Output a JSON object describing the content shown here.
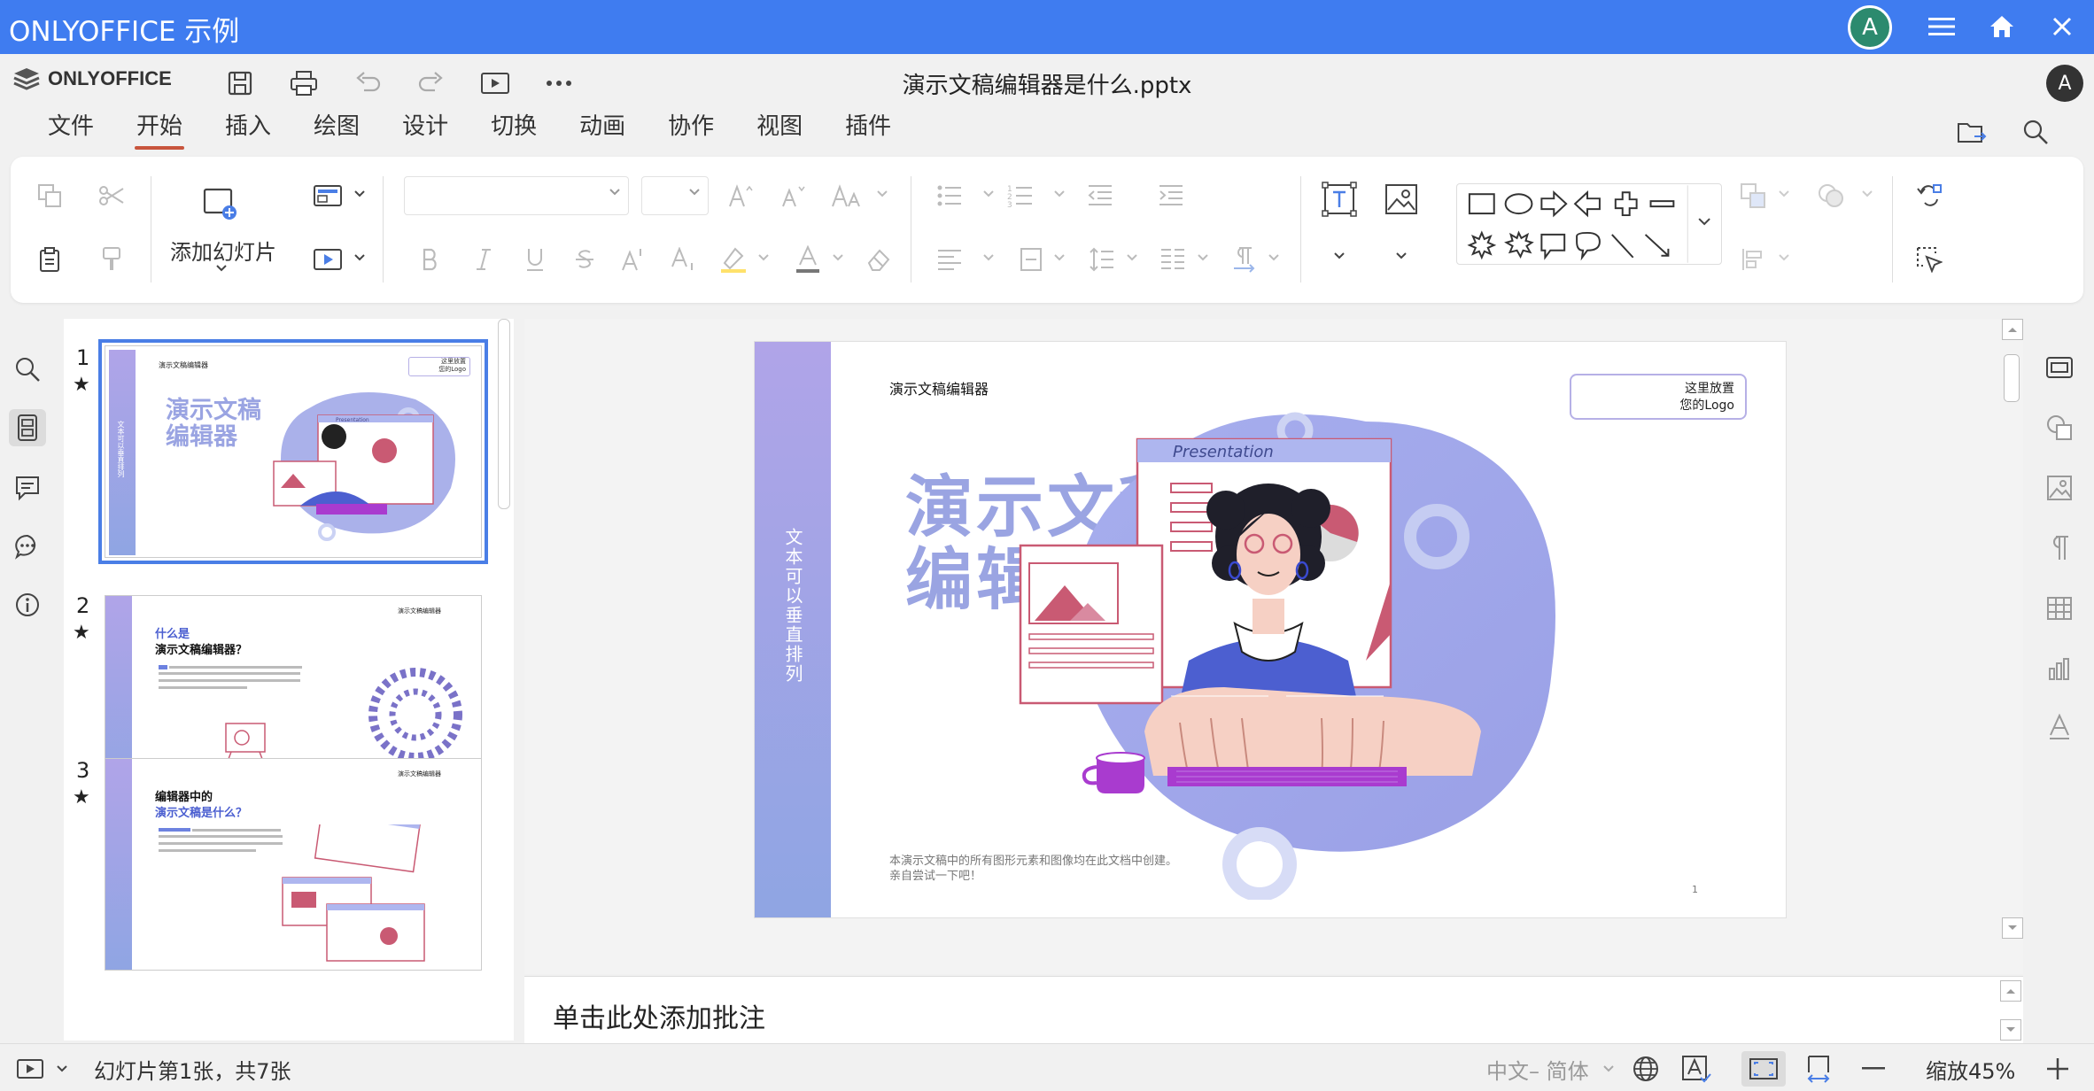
{
  "app": {
    "title": "ONLYOFFICE 示例",
    "avatar_letter": "A"
  },
  "header": {
    "logo_text": "ONLYOFFICE",
    "doc_title": "演示文稿编辑器是什么.pptx",
    "user_letter": "A",
    "tabs": [
      {
        "label": "文件"
      },
      {
        "label": "开始"
      },
      {
        "label": "插入"
      },
      {
        "label": "绘图"
      },
      {
        "label": "设计"
      },
      {
        "label": "切换"
      },
      {
        "label": "动画"
      },
      {
        "label": "协作"
      },
      {
        "label": "视图"
      },
      {
        "label": "插件"
      }
    ],
    "active_tab": "开始"
  },
  "toolbar": {
    "add_slide_label": "添加幻灯片"
  },
  "thumbnails": [
    {
      "number": "1",
      "star": "★",
      "title_small": "演示文稿编辑器",
      "title_big_1": "演示文稿",
      "title_big_2": "编辑器",
      "logo_1": "这里放置",
      "logo_2": "您的Logo",
      "side": "文本可以垂直排列",
      "label": "Presentation"
    },
    {
      "number": "2",
      "star": "★",
      "h1": "什么是",
      "h2": "演示文稿编辑器？",
      "top": "演示文稿编辑器"
    },
    {
      "number": "3",
      "star": "★",
      "h1": "编辑器中的",
      "h2": "演示文稿是什么？",
      "top": "演示文稿编辑器"
    }
  ],
  "slide": {
    "small_title": "演示文稿编辑器",
    "logo_line1": "这里放置",
    "logo_line2": "您的Logo",
    "big_title_line1": "演示文稿",
    "big_title_line2": "编辑器",
    "vertical_text": "文本可以垂直排列",
    "footer_line1": "本演示文稿中的所有图形元素和图像均在此文档中创建。",
    "footer_line2": "亲自尝试一下吧！",
    "page_number": "1",
    "presentation_label": "Presentation"
  },
  "notes": {
    "placeholder": "单击此处添加批注"
  },
  "status": {
    "slide_info": "幻灯片第1张，共7张",
    "language": "中文– 简体",
    "zoom": "缩放45%"
  },
  "colors": {
    "accent_blue": "#3f7cf0",
    "tab_underline": "#c8553d",
    "slide_purple": "#9aa4e2"
  }
}
